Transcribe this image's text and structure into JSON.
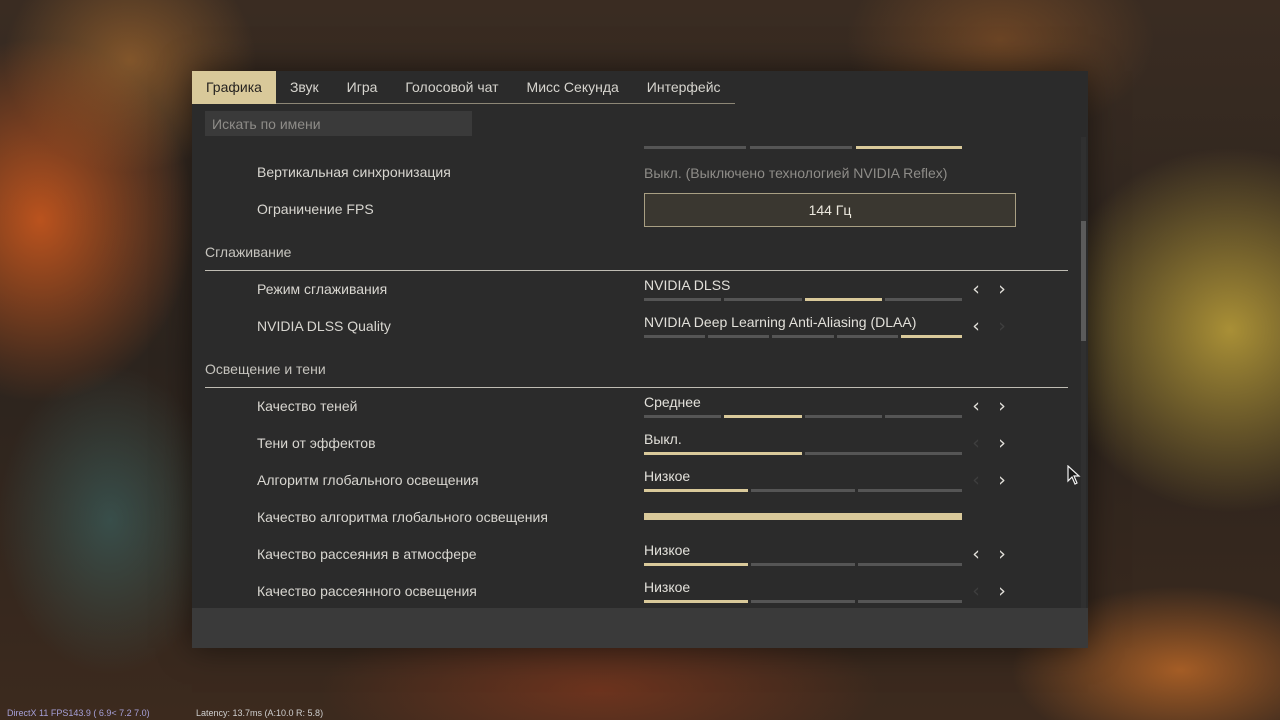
{
  "tabs": [
    {
      "label": "Графика",
      "active": true
    },
    {
      "label": "Звук"
    },
    {
      "label": "Игра"
    },
    {
      "label": "Голосовой чат"
    },
    {
      "label": "Мисс Секунда"
    },
    {
      "label": "Интерфейс"
    }
  ],
  "search": {
    "placeholder": "Искать по имени"
  },
  "colors": {
    "accent": "#d9c99a",
    "panel": "#2b2b2b",
    "inactive_bar": "#555555"
  },
  "settings": {
    "vsync": {
      "label": "Вертикальная синхронизация",
      "value": "Выкл. (Выключено технологией NVIDIA Reflex)"
    },
    "fps_limit": {
      "label": "Ограничение FPS",
      "value": "144 Гц"
    },
    "sections": {
      "antialiasing": "Сглаживание",
      "lighting": "Освещение и тени"
    },
    "aa_mode": {
      "label": "Режим сглаживания",
      "value": "NVIDIA DLSS",
      "selected_index": 2,
      "option_count": 4
    },
    "dlss_quality": {
      "label": "NVIDIA DLSS Quality",
      "value": "NVIDIA Deep Learning Anti-Aliasing (DLAA)",
      "selected_index": 4,
      "option_count": 5
    },
    "shadow_quality": {
      "label": "Качество теней",
      "value": "Среднее",
      "selected_index": 1,
      "option_count": 4
    },
    "effect_shadows": {
      "label": "Тени от эффектов",
      "value": "Выкл.",
      "selected_index": 0,
      "option_count": 2
    },
    "gi_algorithm": {
      "label": "Алгоритм глобального освещения",
      "value": "Низкое",
      "selected_index": 0,
      "option_count": 3
    },
    "gi_quality": {
      "label": "Качество алгоритма глобального освещения",
      "fill": 1.0
    },
    "atmo_scatter": {
      "label": "Качество рассеяния в атмосфере",
      "value": "Низкое",
      "selected_index": 0,
      "option_count": 3
    },
    "diffuse_light": {
      "label": "Качество рассеянного освещения",
      "value": "Низкое",
      "selected_index": 0,
      "option_count": 3
    }
  },
  "icons": {
    "left_arrow": "‹",
    "right_arrow": "›"
  },
  "status_bar": {
    "left": "DirectX 11 FPS143.9 ( 6.9< 7.2 7.0)",
    "mid": "Latency: 13.7ms (A:10.0 R: 5.8)"
  }
}
